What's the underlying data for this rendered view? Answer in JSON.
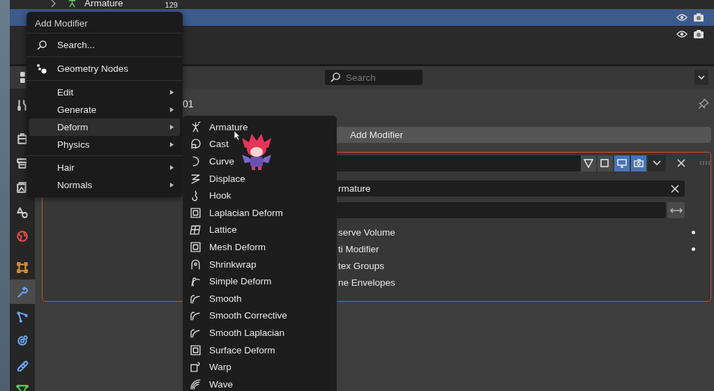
{
  "outliner": {
    "rows": [
      {
        "kind": "armature",
        "label": "Armature",
        "count": "129",
        "selected": false
      },
      {
        "kind": "object",
        "selected": true
      },
      {
        "kind": "object",
        "selected": false
      }
    ]
  },
  "properties": {
    "search": {
      "placeholder": "Search"
    },
    "tab_groups": [
      [
        {
          "kind": "tool",
          "selected": false
        }
      ],
      [
        {
          "kind": "render",
          "selected": false
        },
        {
          "kind": "output",
          "selected": false
        },
        {
          "kind": "view_layer",
          "selected": false
        },
        {
          "kind": "scene",
          "selected": false
        },
        {
          "kind": "world",
          "selected": false
        }
      ],
      [
        {
          "kind": "object",
          "selected": false
        },
        {
          "kind": "modifiers",
          "selected": true
        },
        {
          "kind": "particles",
          "selected": false
        },
        {
          "kind": "physics",
          "selected": false
        },
        {
          "kind": "constraints",
          "selected": false
        },
        {
          "kind": "data",
          "selected": false
        }
      ]
    ],
    "breadcrumb": "01",
    "add_modifier": "Add Modifier",
    "modifier": {
      "toggles": [
        {
          "kind": "edit_mode",
          "on": false
        },
        {
          "kind": "on_cage",
          "on": false
        },
        {
          "kind": "viewport",
          "on": true
        },
        {
          "kind": "render",
          "on": true
        }
      ],
      "rows": [
        {
          "kind": "object_field",
          "value": "rmature"
        },
        {
          "kind": "swap_field"
        },
        {
          "kind": "option",
          "label": "serve Volume",
          "keyed": true
        },
        {
          "kind": "option",
          "label": "ti Modifier",
          "keyed": true
        },
        {
          "kind": "option",
          "label": "tex Groups",
          "keyed": false
        },
        {
          "kind": "option",
          "label": "ne Envelopes",
          "keyed": false
        }
      ]
    }
  },
  "menu": {
    "title": "Add Modifier",
    "sections": [
      [
        {
          "kind": "search",
          "label": "Search...",
          "submenu": false,
          "selected": false
        }
      ],
      [
        {
          "kind": "nodes",
          "label": "Geometry Nodes",
          "submenu": false,
          "selected": false
        }
      ],
      [
        {
          "kind": "plain",
          "label": "Edit",
          "submenu": true,
          "selected": false
        },
        {
          "kind": "plain",
          "label": "Generate",
          "submenu": true,
          "selected": false
        },
        {
          "kind": "plain",
          "label": "Deform",
          "submenu": true,
          "selected": true
        },
        {
          "kind": "plain",
          "label": "Physics",
          "submenu": true,
          "selected": false
        }
      ],
      [
        {
          "kind": "plain",
          "label": "Hair",
          "submenu": true,
          "selected": false
        },
        {
          "kind": "plain",
          "label": "Normals",
          "submenu": true,
          "selected": false
        }
      ]
    ],
    "submenu": {
      "items": [
        {
          "label": "Armature"
        },
        {
          "label": "Cast"
        },
        {
          "label": "Curve"
        },
        {
          "label": "Displace"
        },
        {
          "label": "Hook"
        },
        {
          "label": "Laplacian Deform"
        },
        {
          "label": "Lattice"
        },
        {
          "label": "Mesh Deform"
        },
        {
          "label": "Shrinkwrap"
        },
        {
          "label": "Simple Deform"
        },
        {
          "label": "Smooth"
        },
        {
          "label": "Smooth Corrective"
        },
        {
          "label": "Smooth Laplacian"
        },
        {
          "label": "Surface Deform"
        },
        {
          "label": "Warp"
        },
        {
          "label": "Wave"
        }
      ]
    }
  }
}
